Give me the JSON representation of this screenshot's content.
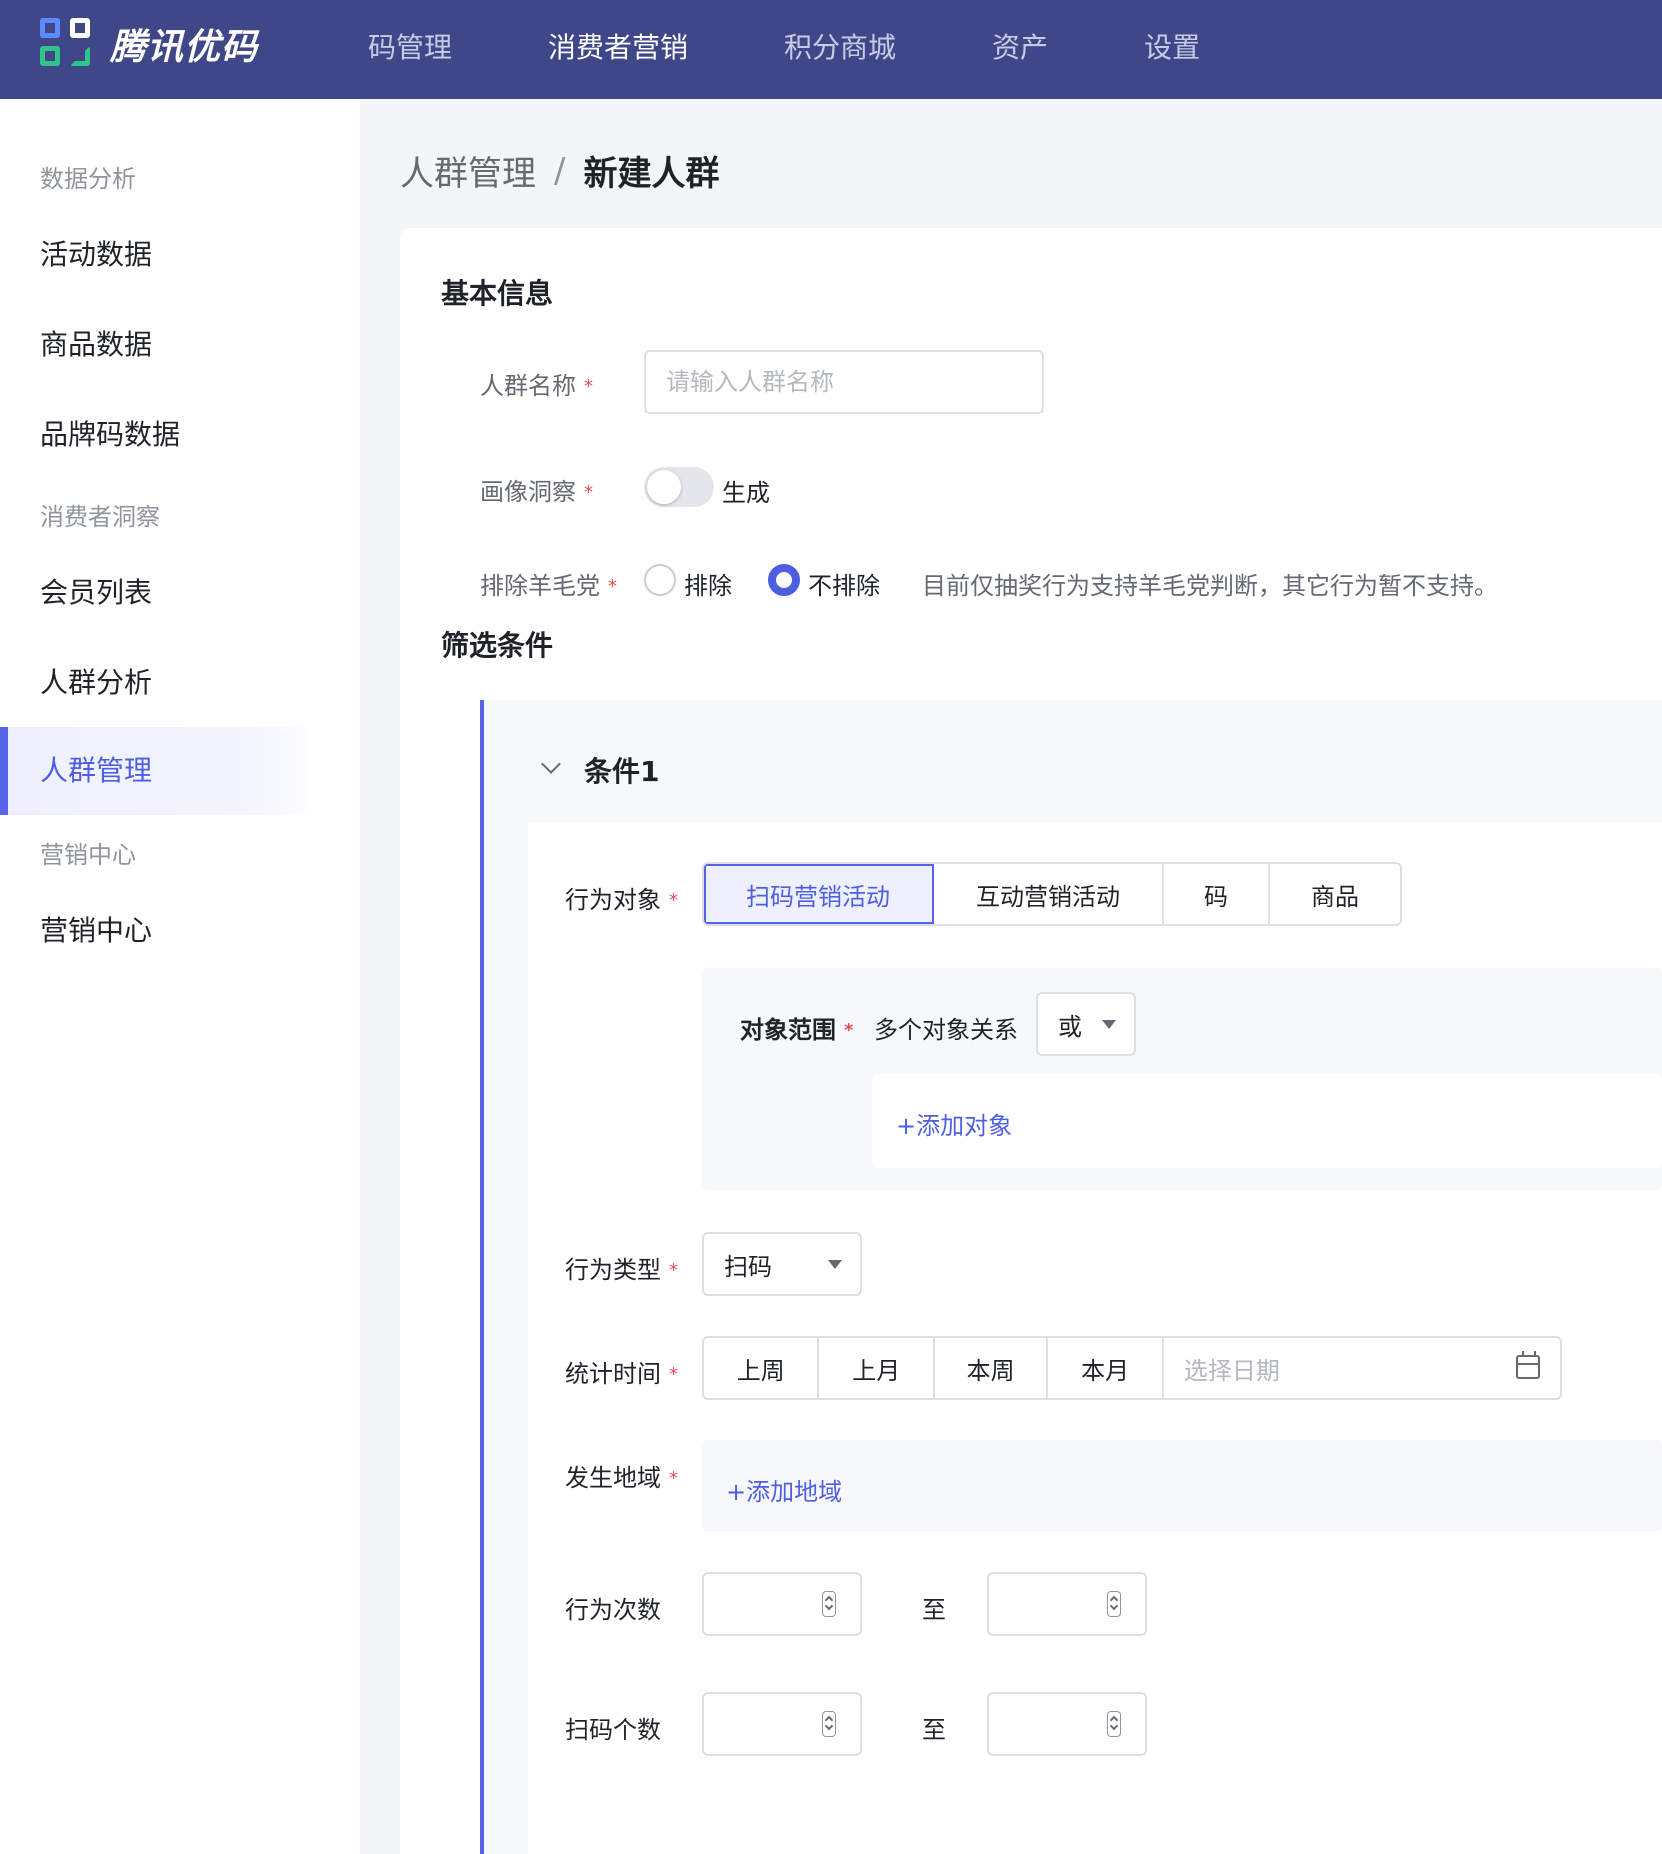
{
  "app": {
    "logo_text": "腾讯优码"
  },
  "topnav": {
    "items": [
      {
        "label": "码管理"
      },
      {
        "label": "消费者营销"
      },
      {
        "label": "积分商城"
      },
      {
        "label": "资产"
      },
      {
        "label": "设置"
      }
    ],
    "active": "消费者营销"
  },
  "sidebar": {
    "groups": [
      {
        "title": "数据分析",
        "items": [
          "活动数据",
          "商品数据",
          "品牌码数据"
        ]
      },
      {
        "title": "消费者洞察",
        "items": [
          "会员列表",
          "人群分析",
          "人群管理"
        ]
      },
      {
        "title": "营销中心",
        "items": [
          "营销中心"
        ]
      }
    ],
    "active": "人群管理"
  },
  "breadcrumb": {
    "parent": "人群管理",
    "separator": "/",
    "current": "新建人群"
  },
  "basic": {
    "title": "基本信息",
    "name_label": "人群名称",
    "name_placeholder": "请输入人群名称",
    "portrait_label": "画像洞察",
    "portrait_toggle_text": "生成",
    "portrait_on": false,
    "exclude_label": "排除羊毛党",
    "exclude_options": [
      "排除",
      "不排除"
    ],
    "exclude_selected": "不排除",
    "exclude_hint": "目前仅抽奖行为支持羊毛党判断，其它行为暂不支持。"
  },
  "filter": {
    "title": "筛选条件",
    "condition": {
      "title": "条件1",
      "target_label": "行为对象",
      "target_options": [
        "扫码营销活动",
        "互动营销活动",
        "码",
        "商品"
      ],
      "target_selected": "扫码营销活动",
      "scope_label": "对象范围",
      "relation_label": "多个对象关系",
      "relation_value": "或",
      "add_object": "+添加对象",
      "behavior_type_label": "行为类型",
      "behavior_type_value": "扫码",
      "stat_time_label": "统计时间",
      "time_options": [
        "上周",
        "上月",
        "本周",
        "本月"
      ],
      "date_placeholder": "选择日期",
      "region_label": "发生地域",
      "add_region": "+添加地域",
      "count_label": "行为次数",
      "to_text": "至",
      "scan_count_label": "扫码个数"
    }
  },
  "colors": {
    "topbar": "#3f4789",
    "accent": "#5664e6",
    "required": "#e34d59"
  }
}
